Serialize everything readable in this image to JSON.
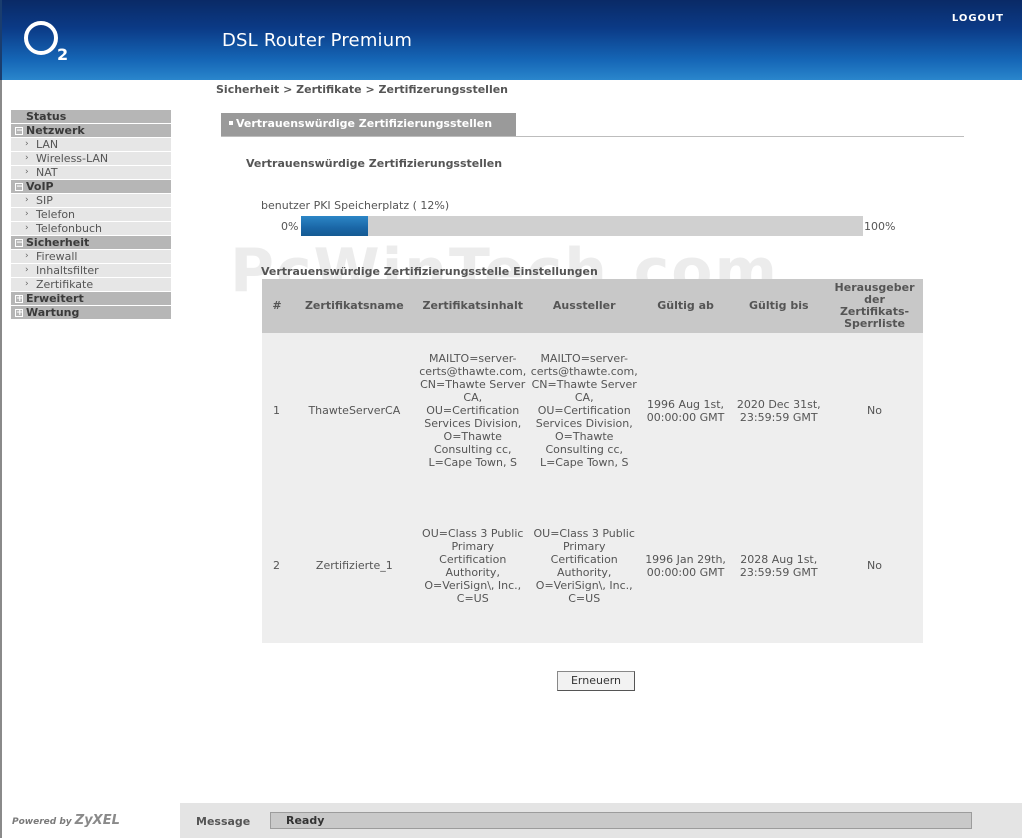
{
  "header": {
    "logo_text": "O2",
    "title": "DSL Router Premium",
    "logout_label": "LOGOUT"
  },
  "breadcrumb": "Sicherheit > Zertifikate > Zertifizerungsstellen",
  "sidebar": {
    "status": "Status",
    "groups": [
      {
        "label": "Netzwerk",
        "expanded": true,
        "items": [
          "LAN",
          "Wireless-LAN",
          "NAT"
        ]
      },
      {
        "label": "VoIP",
        "expanded": true,
        "items": [
          "SIP",
          "Telefon",
          "Telefonbuch"
        ]
      },
      {
        "label": "Sicherheit",
        "expanded": true,
        "items": [
          "Firewall",
          "Inhaltsfilter",
          "Zertifikate"
        ]
      },
      {
        "label": "Erweitert",
        "expanded": false,
        "items": []
      },
      {
        "label": "Wartung",
        "expanded": false,
        "items": []
      }
    ]
  },
  "section": {
    "tab_label": "Vertrauenswürdige Zertifizierungsstellen",
    "subtitle": "Vertrauenswürdige Zertifizierungsstellen"
  },
  "pki": {
    "label": "benutzer PKI Speicherplatz ( 12%)",
    "min_label": "0%",
    "max_label": "100%",
    "fill_fraction": 0.12
  },
  "watermark": "PcWinTech.com",
  "settings": {
    "title": "Vertrauenswürdige Zertifizierungsstelle Einstellungen",
    "columns": [
      "#",
      "Zertifikatsname",
      "Zertifikatsinhalt",
      "Aussteller",
      "Gültig ab",
      "Gültig bis",
      "Herausgeber der Zertifikats-Sperrliste"
    ],
    "rows": [
      {
        "num": "1",
        "name": "ThawteServerCA",
        "content": "MAILTO=server-certs@thawte.com, CN=Thawte Server CA, OU=Certification Services Division, O=Thawte Consulting cc, L=Cape Town, S",
        "issuer": "MAILTO=server-certs@thawte.com, CN=Thawte Server CA, OU=Certification Services Division, O=Thawte Consulting cc, L=Cape Town, S",
        "valid_from": "1996 Aug 1st, 00:00:00 GMT",
        "valid_to": "2020 Dec 31st, 23:59:59 GMT",
        "crl": "No"
      },
      {
        "num": "2",
        "name": "Zertifizierte_1",
        "content": "OU=Class 3 Public Primary Certification Authority, O=VeriSign\\, Inc., C=US",
        "issuer": "OU=Class 3 Public Primary Certification Authority, O=VeriSign\\, Inc., C=US",
        "valid_from": "1996 Jan 29th, 00:00:00 GMT",
        "valid_to": "2028 Aug 1st, 23:59:59 GMT",
        "crl": "No"
      }
    ]
  },
  "renew_label": "Erneuern",
  "footer": {
    "powered_by": "Powered by",
    "brand": "ZyXEL",
    "message_label": "Message",
    "message_text": "Ready"
  },
  "colors": {
    "header_dark": "#0a2a66",
    "header_light": "#2a86cc",
    "progress_fill": "#1a66a6"
  }
}
